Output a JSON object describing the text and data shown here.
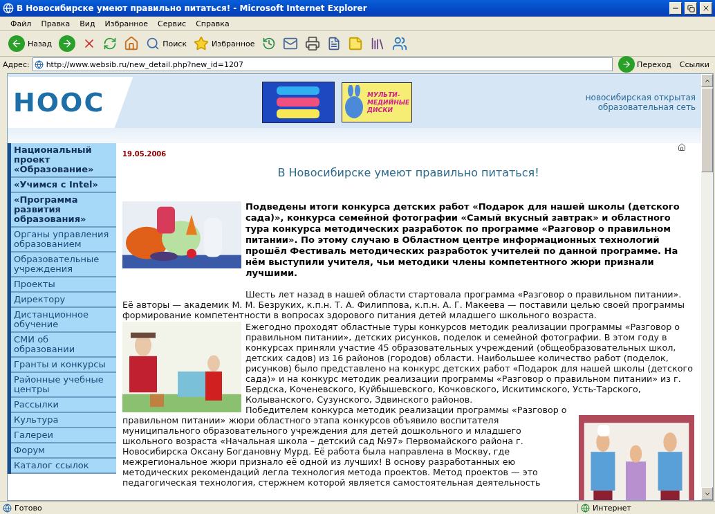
{
  "window": {
    "title": "В Новосибирске умеют правильно питаться! - Microsoft Internet Explorer"
  },
  "menu": [
    {
      "label": "Файл"
    },
    {
      "label": "Правка"
    },
    {
      "label": "Вид"
    },
    {
      "label": "Избранное"
    },
    {
      "label": "Сервис"
    },
    {
      "label": "Справка"
    }
  ],
  "toolbar": [
    {
      "kind": "back",
      "label": "Назад"
    },
    {
      "kind": "forward"
    },
    {
      "kind": "stop"
    },
    {
      "kind": "refresh"
    },
    {
      "kind": "home"
    },
    {
      "kind": "search",
      "label": "Поиск"
    },
    {
      "kind": "favorites",
      "label": "Избранное"
    },
    {
      "kind": "history"
    },
    {
      "kind": "mail"
    },
    {
      "kind": "print"
    },
    {
      "kind": "edit"
    },
    {
      "kind": "note"
    },
    {
      "kind": "research"
    },
    {
      "kind": "messenger"
    }
  ],
  "address": {
    "label": "Адрес:",
    "value": "http://www.websib.ru/new_detail.php?new_id=1207",
    "go": "Переход",
    "links": "Ссылки"
  },
  "header": {
    "logo": "НООС",
    "banner_text": "МУЛЬТИ-МЕДИЙНЫЕ ДИСКИ",
    "tagline": [
      "новосибирская открытая",
      "образовательная сеть"
    ]
  },
  "sidebar": [
    {
      "label": "Национальный проект «Образование»",
      "emphasized": true
    },
    {
      "label": "«Учимся с Intel»",
      "emphasized": true
    },
    {
      "label": "«Программа развития образования»",
      "emphasized": true
    },
    {
      "label": "Органы управления образованием",
      "emphasized": false
    },
    {
      "label": "Образовательные учреждения",
      "emphasized": false
    },
    {
      "label": "Проекты",
      "emphasized": false
    },
    {
      "label": "Директору",
      "emphasized": false
    },
    {
      "label": "Дистанционное обучение",
      "emphasized": false
    },
    {
      "label": "СМИ об образовании",
      "emphasized": false
    },
    {
      "label": "Гранты и конкурсы",
      "emphasized": false
    },
    {
      "label": "Районные учебные центры",
      "emphasized": false
    },
    {
      "label": "Рассылки",
      "emphasized": false
    },
    {
      "label": "Культура",
      "emphasized": false
    },
    {
      "label": "Галереи",
      "emphasized": false
    },
    {
      "label": "Форум",
      "emphasized": false
    },
    {
      "label": "Каталог ссылок",
      "emphasized": false
    }
  ],
  "article": {
    "date": "19.05.2006",
    "headline": "В Новосибирске умеют правильно питаться!",
    "blocks": [
      {
        "kind": "figure-left",
        "texts": [
          {
            "kind": "lead",
            "text": "Подведены итоги конкурса детских работ «Подарок для нашей школы (детского сада)», конкурса семейной фотографии «Самый вкусный завтрак» и областного тура конкурса методических разработок по программе «Разговор о правильном питании». По этому случаю в Областном центре информационных технологий прошёл Фестиваль методических разработок учителей по данной программе. На нём выступили учителя, чьи методики члены компетентного жюри признали лучшими."
          },
          {
            "kind": "text",
            "text": "Шесть лет назад в нашей области стартовала программа «Разговор о правильном питании»."
          }
        ]
      },
      {
        "kind": "text",
        "text": "Её авторы — академик М. М. Безруких, к.п.н. Т. А. Филиппова, к.п.н. А. Г. Макеева — поставили целью своей программы формирование компетентности в вопросах здорового питания детей младшего школьного возраста."
      },
      {
        "kind": "figure-left",
        "texts": [
          {
            "kind": "text",
            "text": "Ежегодно проходят областные туры конкурсов методик реализации программы «Разговор о правильном питании», детских рисунков, поделок и семейной фотографии. В этом году в конкурсах приняли участие 45 образовательных учреждений (общеобразовательных школ, детских садов) из 16 районов (городов) области. Наибольшее количество работ (поделок, рисунков) было представлено на конкурс детских работ «Подарок для нашей школы (детского сада)» и на конкурс методик реализации программы «Разговор о правильном питании» из г. Бердска, Коченевского, Куйбышевского, Кочковского, Искитимского, Усть-Тарского, Колыванского, Сузунского, Здвинского районов."
          },
          {
            "kind": "text",
            "text": "Победителем конкурса методик реализации программы «Разговор о"
          }
        ]
      },
      {
        "kind": "figure-right",
        "texts": [
          {
            "kind": "text",
            "text": "правильном питании» жюри областного этапа конкурсов объявило воспитателя муниципального образовательного учреждения для детей дошкольного и младшего школьного возраста «Начальная школа – детский сад №97» Первомайского района г. Новосибирска Оксану Богдановну Мурд. Её работа была направлена в Москву, где межрегиональное жюри признало её одной из лучших! В основу разработанных ею методических рекомендаций легла технология метода проектов. Метод проектов — это педагогическая технология, стержнем которой является самостоятельная деятельность"
          }
        ]
      }
    ]
  },
  "status": {
    "text": "Готово",
    "zone": "Интернет"
  }
}
